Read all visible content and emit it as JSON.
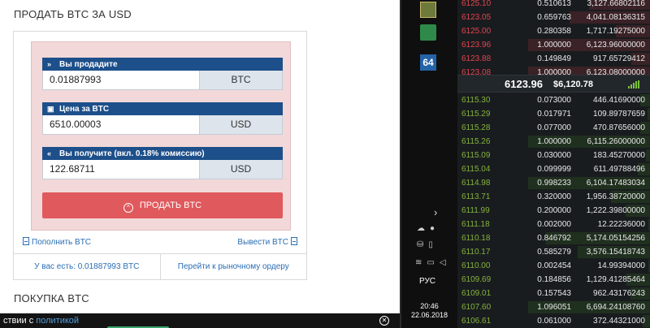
{
  "sell": {
    "title": "ПРОДАТЬ BTC ЗА USD",
    "fields": [
      {
        "label": "Вы продадите",
        "icon": "»",
        "value": "0.01887993",
        "unit": "BTC"
      },
      {
        "label": "Цена за BTC",
        "icon": "▣",
        "value": "6510.00003",
        "unit": "USD"
      },
      {
        "label": "Вы получите (вкл. 0.18% комиссию)",
        "icon": "«",
        "value": "122.68711",
        "unit": "USD"
      }
    ],
    "button": "ПРОДАТЬ BTC",
    "deposit_link": "Пополнить BTC",
    "withdraw_link": "Вывести BTC",
    "balance": "У вас есть: 0.01887993 BTC",
    "market_link": "Перейти к рыночному ордеру"
  },
  "buy": {
    "title": "ПОКУПКА BTC"
  },
  "cookie": {
    "text": "ствии с ",
    "link": "политикой"
  },
  "taskbar": {
    "lang": "РУС",
    "time": "20:46",
    "date": "22.06.2018",
    "icon3_label": "64"
  },
  "orderbook": {
    "asks": [
      {
        "price": "6125.10",
        "amount": "0.510613",
        "total": "3,127.66802116",
        "depth": 0.5
      },
      {
        "price": "6123.05",
        "amount": "0.659763",
        "total": "4,041.08136315",
        "depth": 0.66
      },
      {
        "price": "6125.00",
        "amount": "0.280358",
        "total": "1,717.19275000",
        "depth": 0.28
      },
      {
        "price": "6123.96",
        "amount": "1.000000",
        "total": "6,123.96000000",
        "depth": 1.0
      },
      {
        "price": "6123.88",
        "amount": "0.149849",
        "total": "917.65729412",
        "depth": 0.15
      },
      {
        "price": "6123.08",
        "amount": "1.000000",
        "total": "6,123.08000000",
        "depth": 1.0
      }
    ],
    "last_price": "6123.96",
    "last_usd": "$6,120.78",
    "bids": [
      {
        "price": "6115.30",
        "amount": "0.073000",
        "total": "446.41690000",
        "depth": 0.08
      },
      {
        "price": "6115.29",
        "amount": "0.017971",
        "total": "109.89787659",
        "depth": 0.02
      },
      {
        "price": "6115.28",
        "amount": "0.077000",
        "total": "470.87656000",
        "depth": 0.08
      },
      {
        "price": "6115.26",
        "amount": "1.000000",
        "total": "6,115.26000000",
        "depth": 1.0
      },
      {
        "price": "6115.09",
        "amount": "0.030000",
        "total": "183.45270000",
        "depth": 0.03
      },
      {
        "price": "6115.04",
        "amount": "0.099999",
        "total": "611.49788496",
        "depth": 0.1
      },
      {
        "price": "6114.98",
        "amount": "0.998233",
        "total": "6,104.17483034",
        "depth": 1.0
      },
      {
        "price": "6113.71",
        "amount": "0.320000",
        "total": "1,956.38720000",
        "depth": 0.32
      },
      {
        "price": "6111.99",
        "amount": "0.200000",
        "total": "1,222.39800000",
        "depth": 0.2
      },
      {
        "price": "6111.18",
        "amount": "0.002000",
        "total": "12.22236000",
        "depth": 0.01
      },
      {
        "price": "6110.18",
        "amount": "0.846792",
        "total": "5,174.05154256",
        "depth": 0.85
      },
      {
        "price": "6110.17",
        "amount": "0.585279",
        "total": "3,576.15418743",
        "depth": 0.59
      },
      {
        "price": "6110.00",
        "amount": "0.002454",
        "total": "14.99394000",
        "depth": 0.01
      },
      {
        "price": "6109.69",
        "amount": "0.184856",
        "total": "1,129.41285464",
        "depth": 0.19
      },
      {
        "price": "6109.01",
        "amount": "0.157543",
        "total": "962.43176243",
        "depth": 0.16
      },
      {
        "price": "6107.60",
        "amount": "1.096051",
        "total": "6,694.24108760",
        "depth": 1.0
      },
      {
        "price": "6106.61",
        "amount": "0.061000",
        "total": "372.44321000",
        "depth": 0.06
      }
    ]
  }
}
